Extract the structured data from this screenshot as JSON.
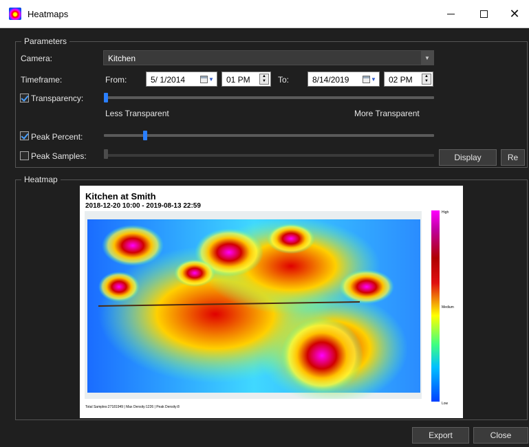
{
  "window": {
    "title": "Heatmaps",
    "minimize_icon": "minimize-icon",
    "maximize_icon": "maximize-icon",
    "close_symbol": "✕"
  },
  "parameters": {
    "group_title": "Parameters",
    "camera_label": "Camera:",
    "camera_value": "Kitchen",
    "timeframe_label": "Timeframe:",
    "from_label": "From:",
    "from_date": "5/ 1/2014",
    "from_time": "01 PM",
    "to_label": "To:",
    "to_date": "8/14/2019",
    "to_time": "02 PM",
    "transparency_label": "Transparency:",
    "transparency_checked": true,
    "transparency_value_pct": 0,
    "less_transparent_label": "Less Transparent",
    "more_transparent_label": "More Transparent",
    "peak_percent_label": "Peak Percent:",
    "peak_percent_checked": true,
    "peak_percent_value_pct": 12,
    "peak_samples_label": "Peak Samples:",
    "peak_samples_checked": false,
    "display_button": "Display",
    "reset_button": "Re"
  },
  "heatmap": {
    "group_title": "Heatmap",
    "image_title": "Kitchen at Smith",
    "image_range": "2018-12-20 10:00 - 2019-08-13 22:59",
    "colorbar_high": "High",
    "colorbar_medium": "Medium",
    "colorbar_low": "Low",
    "footer": "Total Samples:27181949 | Max Density:1226 | Peak Density:8",
    "colors": {
      "low": "#0040ff",
      "mid": "#ffff00",
      "high": "#ff00ff"
    }
  },
  "footer": {
    "export_button": "Export",
    "close_button": "Close"
  }
}
